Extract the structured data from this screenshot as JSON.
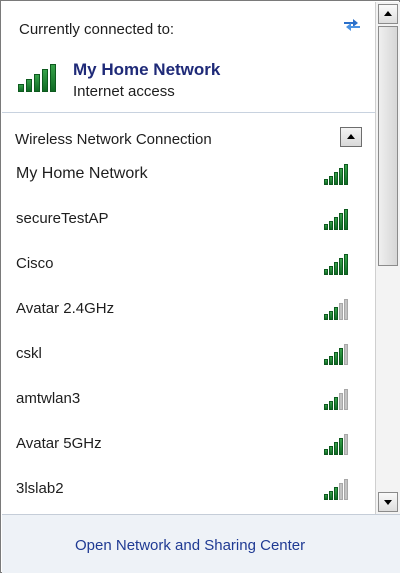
{
  "header": {
    "label": "Currently connected to:",
    "refresh_icon": "refresh-arrows-icon",
    "connection": {
      "name": "My Home Network",
      "status": "Internet access",
      "signal_level": 5,
      "signal_icon": "wifi-signal-icon"
    }
  },
  "section": {
    "label": "Wireless Network Connection",
    "collapse_icon": "collapse-up-icon"
  },
  "networks": [
    {
      "name": "My Home Network",
      "signal_level": 5
    },
    {
      "name": "secureTestAP",
      "signal_level": 5
    },
    {
      "name": "Cisco",
      "signal_level": 5
    },
    {
      "name": "Avatar 2.4GHz",
      "signal_level": 3
    },
    {
      "name": "cskl",
      "signal_level": 4
    },
    {
      "name": "amtwlan3",
      "signal_level": 3
    },
    {
      "name": "Avatar 5GHz",
      "signal_level": 4
    },
    {
      "name": "3lslab2",
      "signal_level": 3
    }
  ],
  "footer": {
    "link": "Open Network and Sharing Center"
  },
  "colors": {
    "signal_on": "#1f8a34",
    "signal_off": "#c3c3c3",
    "connection_name": "#1f2a78",
    "link": "#1f3a93"
  }
}
